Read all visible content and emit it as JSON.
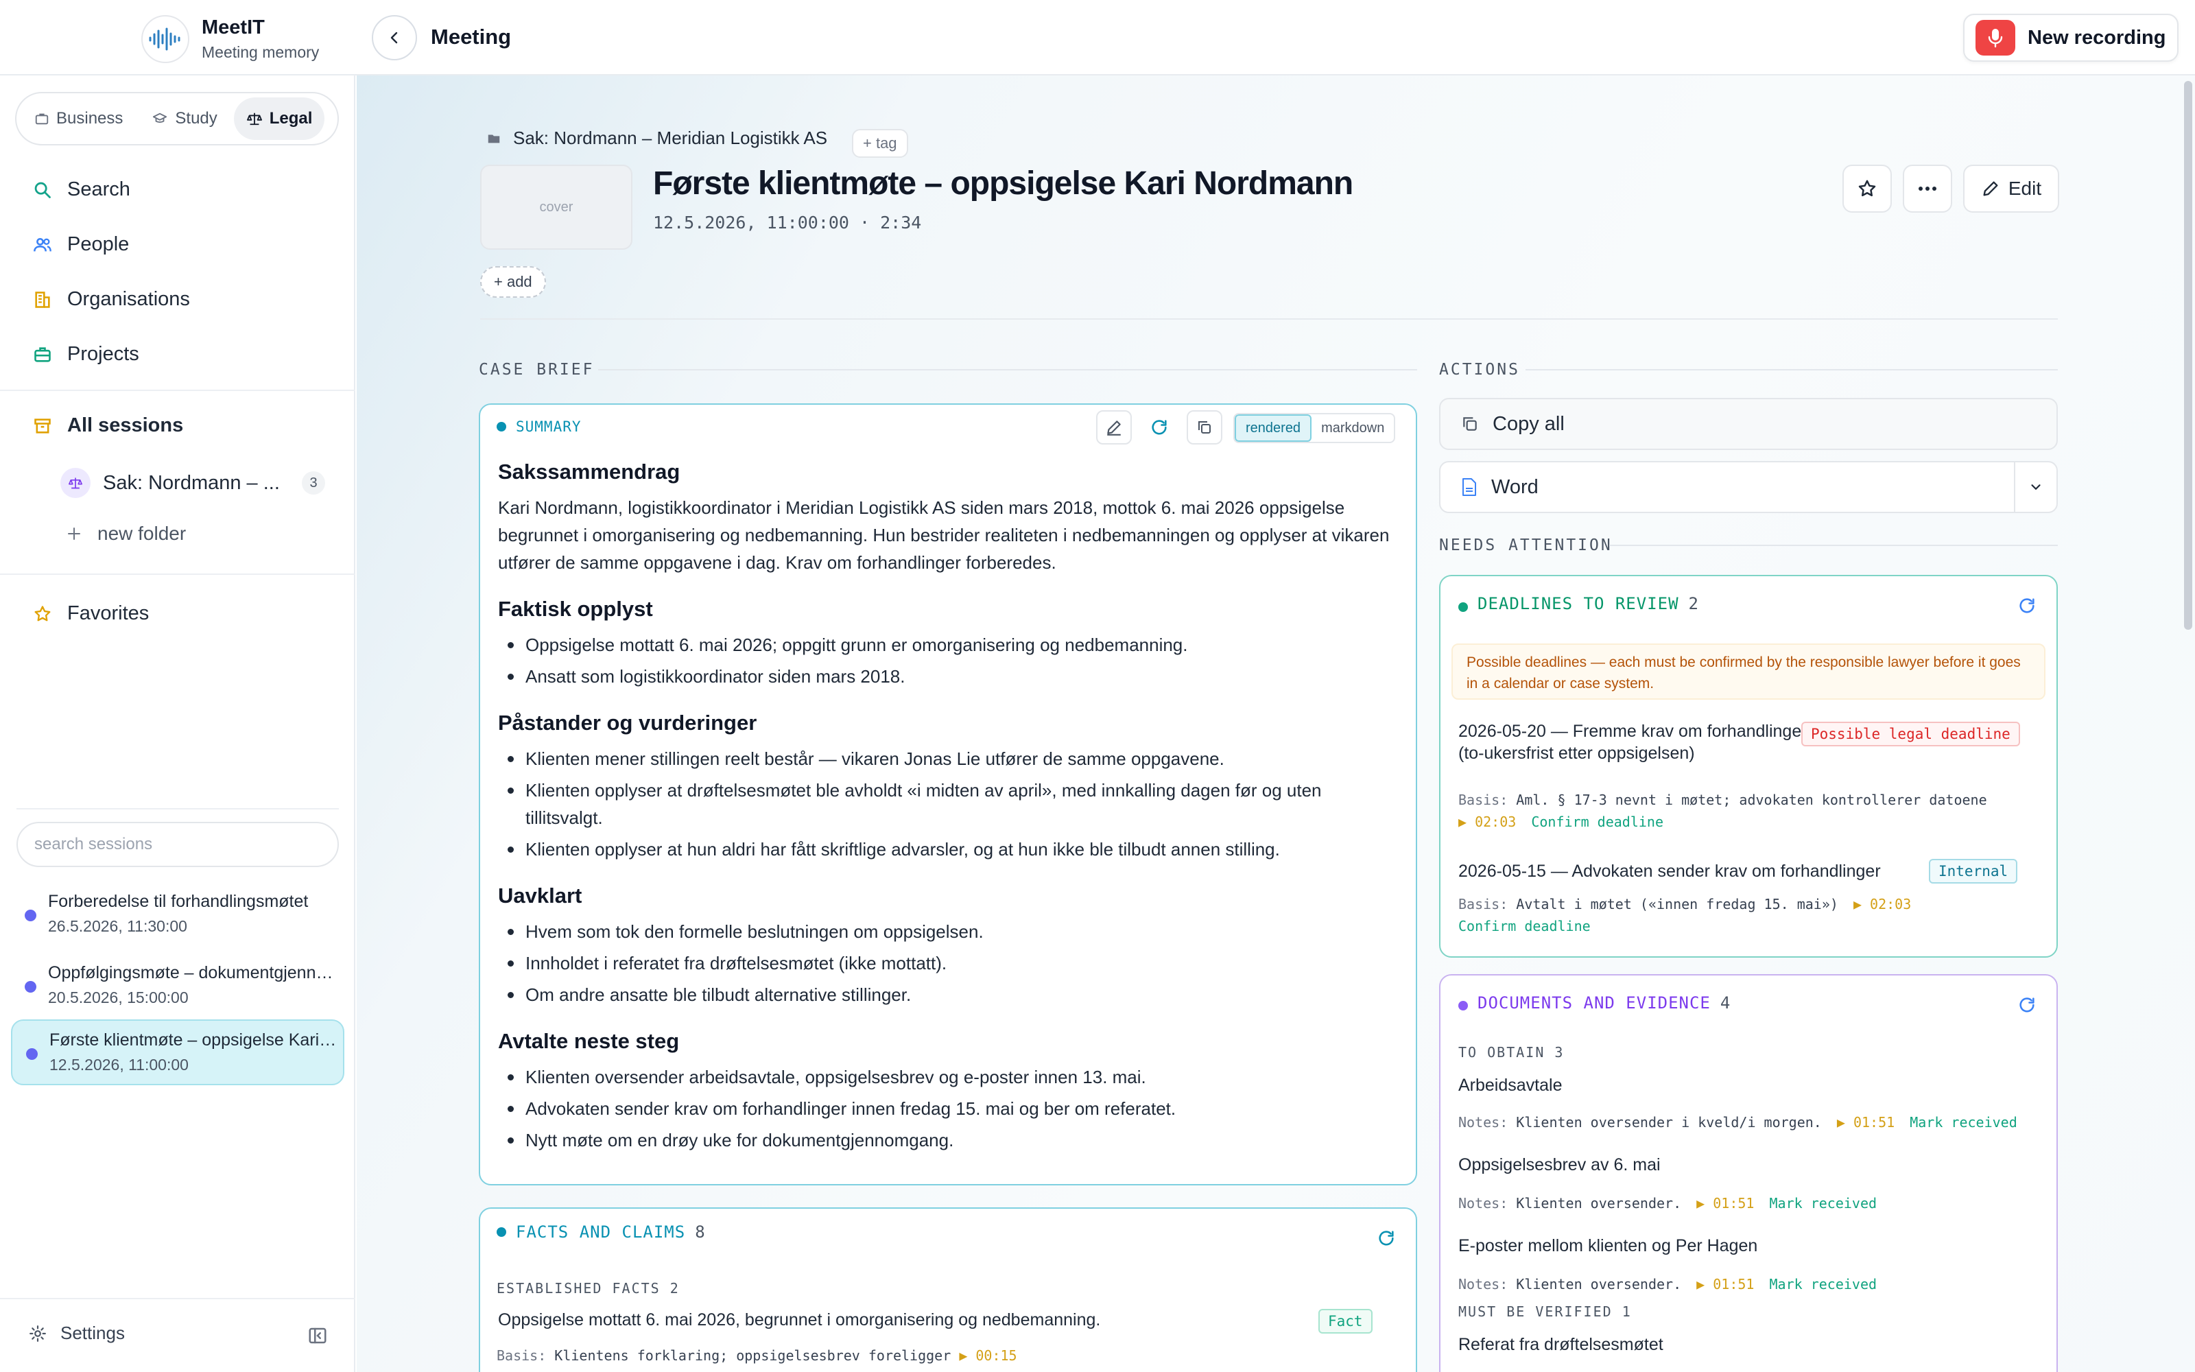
{
  "app": {
    "name": "MeetIT",
    "subtitle": "Meeting memory"
  },
  "topbar": {
    "title": "Meeting",
    "new_recording": "New recording"
  },
  "sidebar": {
    "modes": [
      {
        "label": "Business"
      },
      {
        "label": "Study"
      },
      {
        "label": "Legal",
        "active": true
      }
    ],
    "nav": {
      "search": "Search",
      "people": "People",
      "organisations": "Organisations",
      "projects": "Projects",
      "all_sessions": "All sessions",
      "favorites": "Favorites"
    },
    "folder": {
      "label": "Sak: Nordmann – ...",
      "count": "3"
    },
    "new_folder": "new folder",
    "search_placeholder": "search sessions",
    "sessions": [
      {
        "title": "Forberedelse til forhandlingsmøtet",
        "date": "26.5.2026, 11:30:00"
      },
      {
        "title": "Oppfølgingsmøte – dokumentgjennomgang",
        "date": "20.5.2026, 15:00:00"
      },
      {
        "title": "Første klientmøte – oppsigelse Kari Nordmann",
        "date": "12.5.2026, 11:00:00",
        "active": true
      }
    ],
    "settings": "Settings"
  },
  "meeting": {
    "breadcrumb": "Sak: Nordmann – Meridian Logistikk AS",
    "tag_btn": "+ tag",
    "cover": "cover",
    "title": "Første klientmøte – oppsigelse Kari Nordmann",
    "meta": "12.5.2026, 11:00:00 · 2:34",
    "add_btn": "+ add",
    "edit": "Edit"
  },
  "case_brief": {
    "section": "CASE BRIEF",
    "summary_label": "SUMMARY",
    "view_rendered": "rendered",
    "view_markdown": "markdown",
    "heading": "Sakssammendrag",
    "intro": "Kari Nordmann, logistikkoordinator i Meridian Logistikk AS siden mars 2018, mottok 6. mai 2026 oppsigelse begrunnet i omorganisering og nedbemanning. Hun bestrider realiteten i nedbemanningen og opplyser at vikaren utfører de samme oppgavene i dag. Krav om forhandlinger forberedes.",
    "sections": [
      {
        "heading": "Faktisk opplyst",
        "items": [
          "Oppsigelse mottatt 6. mai 2026; oppgitt grunn er omorganisering og nedbemanning.",
          "Ansatt som logistikkoordinator siden mars 2018."
        ]
      },
      {
        "heading": "Påstander og vurderinger",
        "items": [
          "Klienten mener stillingen reelt består — vikaren Jonas Lie utfører de samme oppgavene.",
          "Klienten opplyser at drøftelsesmøtet ble avholdt «i midten av april», med innkalling dagen før og uten tillitsvalgt.",
          "Klienten opplyser at hun aldri har fått skriftlige advarsler, og at hun ikke ble tilbudt annen stilling."
        ]
      },
      {
        "heading": "Uavklart",
        "items": [
          "Hvem som tok den formelle beslutningen om oppsigelsen.",
          "Innholdet i referatet fra drøftelsesmøtet (ikke mottatt).",
          "Om andre ansatte ble tilbudt alternative stillinger."
        ]
      },
      {
        "heading": "Avtalte neste steg",
        "items": [
          "Klienten oversender arbeidsavtale, oppsigelsesbrev og e-poster innen 13. mai.",
          "Advokaten sender krav om forhandlinger innen fredag 15. mai og ber om referatet.",
          "Nytt møte om en drøy uke for dokumentgjennomgang."
        ]
      }
    ],
    "facts": {
      "label": "FACTS AND CLAIMS",
      "count": "8",
      "established_label": "ESTABLISHED FACTS",
      "established_count": "2",
      "first_fact": "Oppsigelse mottatt 6. mai 2026, begrunnet i omorganisering og nedbemanning.",
      "first_fact_badge": "Fact",
      "first_fact_basis_label": "Basis:",
      "first_fact_basis": "Klientens forklaring; oppsigelsesbrev foreligger",
      "first_fact_ts": "▶ 00:15"
    }
  },
  "actions": {
    "section": "ACTIONS",
    "copy_all": "Copy all",
    "word": "Word"
  },
  "needs_attention": {
    "section": "NEEDS ATTENTION",
    "deadlines": {
      "label": "DEADLINES TO REVIEW",
      "count": "2",
      "warning": "Possible deadlines — each must be confirmed by the responsible lawyer before it goes in a calendar or case system.",
      "items": [
        {
          "title": "2026-05-20 — Fremme krav om forhandlinger (to-ukersfrist etter oppsigelsen)",
          "badge": "Possible legal deadline",
          "basis_label": "Basis:",
          "basis": "Aml. § 17-3 nevnt i møtet; advokaten kontrollerer datoene",
          "ts": "▶ 02:03",
          "link": "Confirm deadline"
        },
        {
          "title": "2026-05-15 — Advokaten sender krav om forhandlinger",
          "badge": "Internal",
          "basis_label": "Basis:",
          "basis": "Avtalt i møtet («innen fredag 15. mai»)",
          "ts": "▶ 02:03",
          "link": "Confirm deadline"
        }
      ]
    },
    "documents": {
      "label": "DOCUMENTS AND EVIDENCE",
      "count": "4",
      "obtain_label": "TO OBTAIN",
      "obtain_count": "3",
      "items": [
        {
          "title": "Arbeidsavtale",
          "notes_label": "Notes:",
          "notes": "Klienten oversender i kveld/i morgen.",
          "ts": "▶ 01:51",
          "link": "Mark received"
        },
        {
          "title": "Oppsigelsesbrev av 6. mai",
          "notes_label": "Notes:",
          "notes": "Klienten oversender.",
          "ts": "▶ 01:51",
          "link": "Mark received"
        },
        {
          "title": "E-poster mellom klienten og Per Hagen",
          "notes_label": "Notes:",
          "notes": "Klienten oversender.",
          "ts": "▶ 01:51",
          "link": "Mark received"
        }
      ],
      "verify_label": "MUST BE VERIFIED",
      "verify_count": "1",
      "verify_item": "Referat fra drøftelsesmøtet"
    }
  },
  "colors": {
    "accent": "#0891b2",
    "record": "#ef4444",
    "deadline": "#10a37f",
    "documents": "#7c3aed",
    "session_dot": "#6366f1"
  }
}
